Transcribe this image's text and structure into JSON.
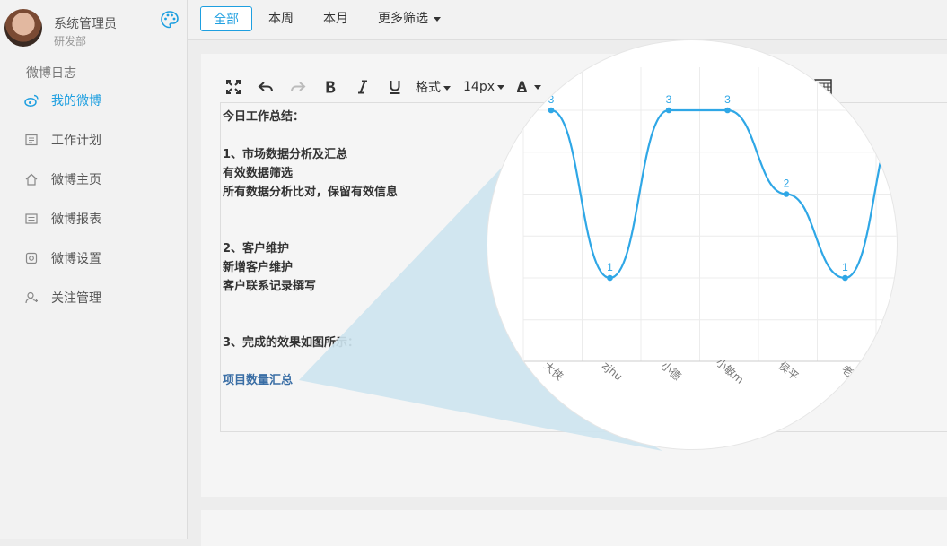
{
  "user": {
    "name": "系统管理员",
    "dept": "研发部"
  },
  "sidebar": {
    "section_title": "微博日志",
    "items": [
      {
        "label": "我的微博",
        "icon": "weibo-icon",
        "active": true
      },
      {
        "label": "工作计划",
        "icon": "plan-icon"
      },
      {
        "label": "微博主页",
        "icon": "home-icon"
      },
      {
        "label": "微博报表",
        "icon": "report-icon"
      },
      {
        "label": "微博设置",
        "icon": "settings-icon"
      },
      {
        "label": "关注管理",
        "icon": "follow-icon"
      }
    ]
  },
  "filters": {
    "all": "全部",
    "week": "本周",
    "month": "本月",
    "more": "更多筛选"
  },
  "toolbar": {
    "format": "格式",
    "font_size": "14px",
    "font_color": "A"
  },
  "document": {
    "lines": [
      "今日工作总结：",
      "",
      "1、市场数据分析及汇总",
      "有效数据筛选",
      "所有数据分析比对，保留有效信息",
      "",
      "",
      "2、客户维护",
      "新增客户维护",
      "客户联系记录撰写",
      "",
      "",
      "3、完成的效果如图所示："
    ],
    "link": "项目数量汇总"
  },
  "colors": {
    "accent": "#1e9fe0",
    "line": "#2fa7e6",
    "beam": "#cde4f0"
  },
  "chart_data": {
    "type": "line",
    "smooth": true,
    "categories": [
      "大侠",
      "zjhu",
      "小德",
      "小敏m",
      "侯平",
      "老"
    ],
    "series": [
      {
        "values": [
          3,
          1,
          3,
          3,
          2,
          1
        ]
      }
    ],
    "data_labels": [
      "3",
      "1",
      "3",
      "3",
      "2",
      "1"
    ],
    "grid": true
  }
}
